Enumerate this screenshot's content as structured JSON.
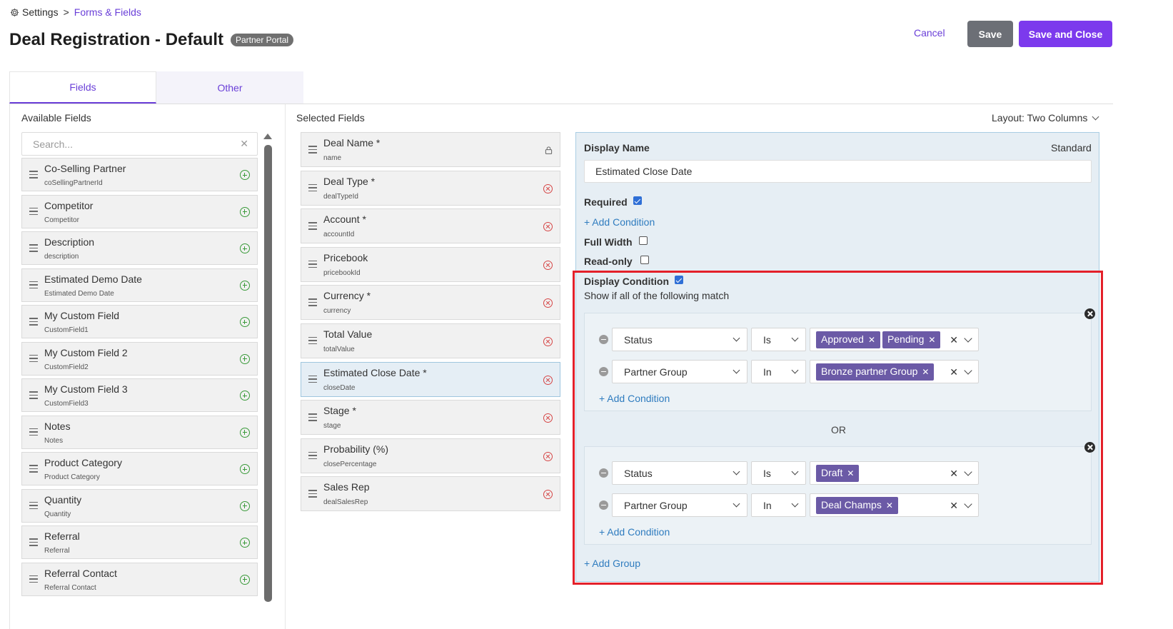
{
  "breadcrumb": {
    "root": "Settings",
    "separator": ">",
    "current": "Forms & Fields"
  },
  "header": {
    "title": "Deal Registration - Default",
    "badge": "Partner Portal",
    "cancel_label": "Cancel",
    "save_label": "Save",
    "save_close_label": "Save and Close"
  },
  "tabs": [
    {
      "label": "Fields",
      "active": true
    },
    {
      "label": "Other",
      "active": false
    }
  ],
  "available": {
    "title": "Available Fields",
    "search_placeholder": "Search...",
    "items": [
      {
        "label": "Co-Selling Partner",
        "key": "coSellingPartnerId"
      },
      {
        "label": "Competitor",
        "key": "Competitor"
      },
      {
        "label": "Description",
        "key": "description"
      },
      {
        "label": "Estimated Demo Date",
        "key": "Estimated Demo Date"
      },
      {
        "label": "My Custom Field",
        "key": "CustomField1"
      },
      {
        "label": "My Custom Field 2",
        "key": "CustomField2"
      },
      {
        "label": "My Custom Field 3",
        "key": "CustomField3"
      },
      {
        "label": "Notes",
        "key": "Notes"
      },
      {
        "label": "Product Category",
        "key": "Product Category"
      },
      {
        "label": "Quantity",
        "key": "Quantity"
      },
      {
        "label": "Referral",
        "key": "Referral"
      },
      {
        "label": "Referral Contact",
        "key": "Referral Contact"
      }
    ]
  },
  "selected": {
    "title": "Selected Fields",
    "layout_label": "Layout: Two Columns",
    "items": [
      {
        "label": "Deal Name *",
        "key": "name",
        "locked": true
      },
      {
        "label": "Deal Type *",
        "key": "dealTypeId"
      },
      {
        "label": "Account *",
        "key": "accountId"
      },
      {
        "label": "Pricebook",
        "key": "pricebookId"
      },
      {
        "label": "Currency *",
        "key": "currency"
      },
      {
        "label": "Total Value",
        "key": "totalValue"
      },
      {
        "label": "Estimated Close Date *",
        "key": "closeDate",
        "selected": true
      },
      {
        "label": "Stage *",
        "key": "stage"
      },
      {
        "label": "Probability (%)",
        "key": "closePercentage"
      },
      {
        "label": "Sales Rep",
        "key": "dealSalesRep"
      }
    ]
  },
  "detail": {
    "display_name_label": "Display Name",
    "type_label": "Standard",
    "display_name_value": "Estimated Close Date",
    "required_label": "Required",
    "add_condition_label": "+ Add Condition",
    "full_width_label": "Full Width",
    "readonly_label": "Read-only",
    "display_condition_label": "Display Condition",
    "match_text": "Show if all of the following match",
    "or_label": "OR",
    "add_group_label": "+ Add Group",
    "groups": [
      {
        "conditions": [
          {
            "field": "Status",
            "operator": "Is",
            "values": [
              "Approved",
              "Pending"
            ]
          },
          {
            "field": "Partner Group",
            "operator": "In",
            "values": [
              "Bronze partner Group"
            ]
          }
        ],
        "add_condition_label": "+ Add Condition"
      },
      {
        "conditions": [
          {
            "field": "Status",
            "operator": "Is",
            "values": [
              "Draft"
            ]
          },
          {
            "field": "Partner Group",
            "operator": "In",
            "values": [
              "Deal Champs"
            ]
          }
        ],
        "add_condition_label": "+ Add Condition"
      }
    ]
  },
  "colors": {
    "accent": "#7c3aed",
    "link": "#2f7cbf",
    "tag": "#6b5aa6",
    "highlight": "#e3202a",
    "remove": "#d64545",
    "add": "#3a9a3a"
  },
  "icons": {
    "settings": "gear-icon",
    "drag": "drag-handle-icon",
    "add": "add-circle-icon",
    "remove": "remove-circle-icon",
    "lock": "lock-icon"
  }
}
